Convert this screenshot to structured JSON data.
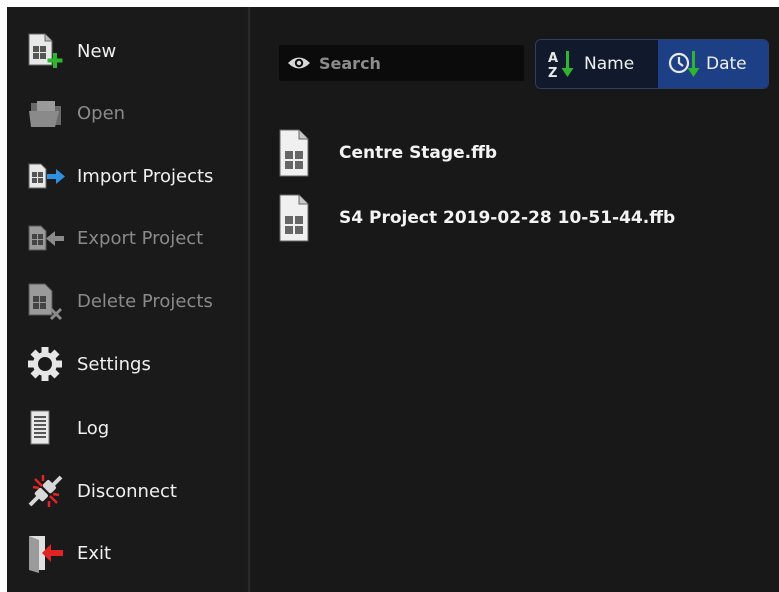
{
  "sidebar": {
    "items": [
      {
        "label": "New",
        "icon": "new-project-icon",
        "enabled": true
      },
      {
        "label": "Open",
        "icon": "open-folder-icon",
        "enabled": false
      },
      {
        "label": "Import Projects",
        "icon": "import-projects-icon",
        "enabled": true
      },
      {
        "label": "Export Project",
        "icon": "export-project-icon",
        "enabled": false
      },
      {
        "label": "Delete Projects",
        "icon": "delete-projects-icon",
        "enabled": false
      },
      {
        "label": "Settings",
        "icon": "gear-icon",
        "enabled": true
      },
      {
        "label": "Log",
        "icon": "log-document-icon",
        "enabled": true
      },
      {
        "label": "Disconnect",
        "icon": "disconnect-plug-icon",
        "enabled": true
      },
      {
        "label": "Exit",
        "icon": "exit-door-icon",
        "enabled": true
      }
    ]
  },
  "search": {
    "placeholder": "Search",
    "icon": "eye-icon"
  },
  "sort": {
    "name_label": "Name",
    "date_label": "Date",
    "active": "Date",
    "name_icon": "sort-alpha-icon",
    "date_icon": "sort-clock-icon"
  },
  "files": [
    {
      "name": "Centre Stage.ffb",
      "icon": "project-file-icon"
    },
    {
      "name": "S4 Project 2019-02-28 10-51-44.ffb",
      "icon": "project-file-icon"
    }
  ],
  "colors": {
    "background": "#1c1c1c",
    "active_sort": "#1c3f86",
    "accent_green": "#2fb52f",
    "accent_blue": "#2f8fe0",
    "accent_red": "#e02424"
  }
}
